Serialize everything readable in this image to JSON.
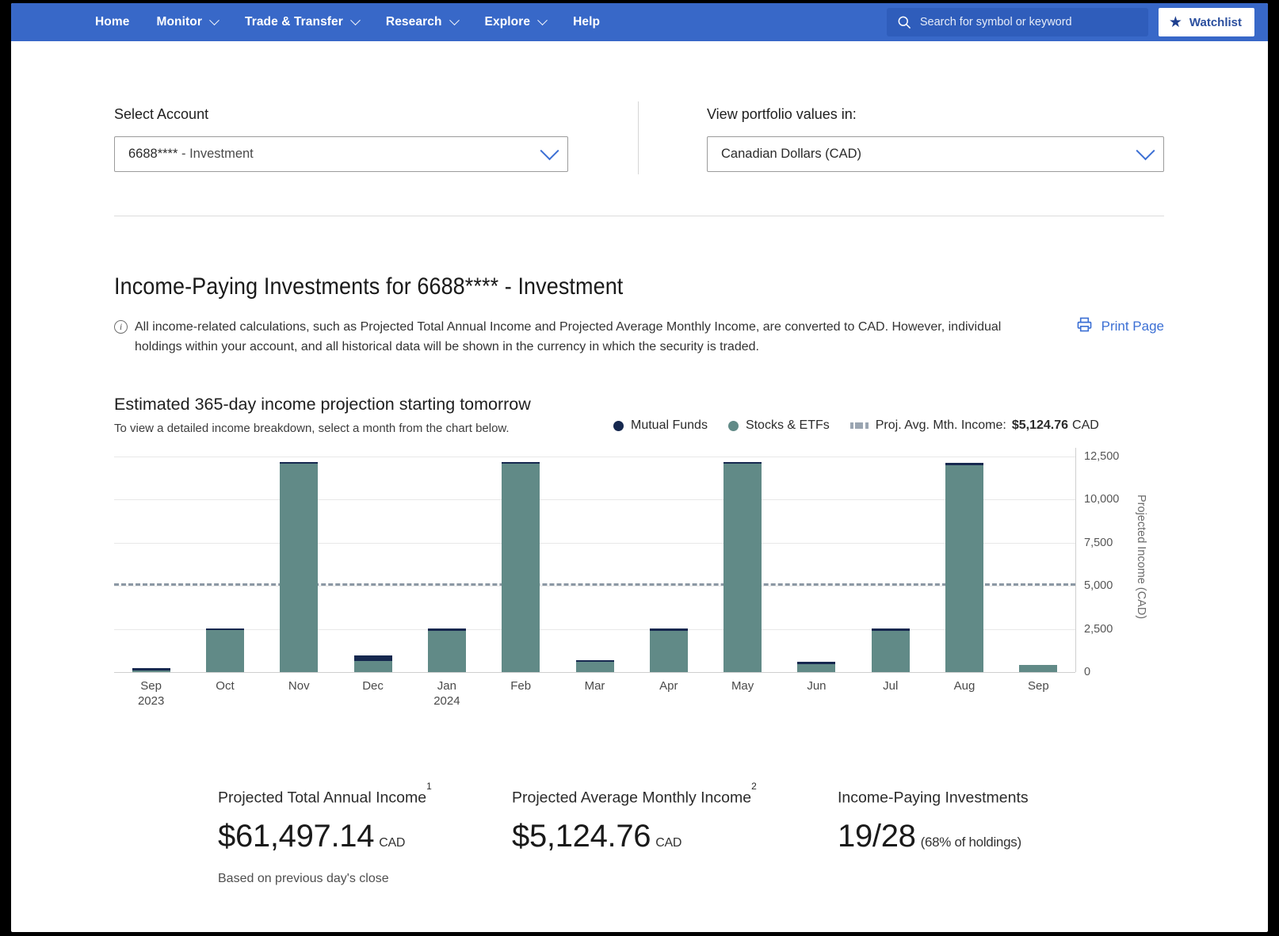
{
  "nav": {
    "items": [
      {
        "label": "Home",
        "caret": false
      },
      {
        "label": "Monitor",
        "caret": true
      },
      {
        "label": "Trade & Transfer",
        "caret": true
      },
      {
        "label": "Research",
        "caret": true
      },
      {
        "label": "Explore",
        "caret": true
      },
      {
        "label": "Help",
        "caret": false
      }
    ],
    "search_placeholder": "Search for symbol or keyword",
    "search_value": "",
    "watchlist_label": "Watchlist",
    "star_icon": "star-icon",
    "search_icon": "search-icon",
    "brand_color": "#3868c8"
  },
  "selectors": {
    "account_label": "Select Account",
    "account_value": "6688****",
    "account_value_suffix": "- Investment",
    "currency_label": "View portfolio values in:",
    "currency_value": "Canadian Dollars (CAD)"
  },
  "header": {
    "title": "Income-Paying Investments for 6688****  - Investment",
    "info_icon": "info-circle-icon",
    "info_text": "All income-related calculations, such as Projected Total Annual Income and Projected Average Monthly Income, are converted to CAD. However, individual holdings within your account, and all historical data will be shown in the currency in which the security is traded.",
    "print_label": "Print Page",
    "print_icon": "printer-icon"
  },
  "chart_section": {
    "title": "Estimated 365-day income projection starting tomorrow",
    "subtitle": "To view a detailed income breakdown, select a month from the chart below.",
    "legend": {
      "mutual_funds": "Mutual Funds",
      "stocks_etfs": "Stocks & ETFs",
      "avg_label": "Proj. Avg. Mth. Income:",
      "avg_value": "$5,124.76",
      "avg_currency": "CAD"
    }
  },
  "chart_data": {
    "type": "bar",
    "stacked": true,
    "title": "Estimated 365-day income projection starting tomorrow",
    "xlabel": "",
    "ylabel": "Projected Income (CAD)",
    "ylim": [
      0,
      13000
    ],
    "yticks": [
      0,
      2500,
      5000,
      7500,
      10000,
      12500
    ],
    "ytick_labels": [
      "0",
      "2,500",
      "5,000",
      "7,500",
      "10,000",
      "12,500"
    ],
    "grid": true,
    "legend_position": "top-right",
    "categories": [
      "Sep",
      "Oct",
      "Nov",
      "Dec",
      "Jan",
      "Feb",
      "Mar",
      "Apr",
      "May",
      "Jun",
      "Jul",
      "Aug",
      "Sep"
    ],
    "category_sublabels": [
      "2023",
      "",
      "",
      "",
      "2024",
      "",
      "",
      "",
      "",
      "",
      "",
      "",
      ""
    ],
    "series": [
      {
        "name": "Stocks & ETFs",
        "color": "#618a87",
        "values": [
          110,
          2420,
          12060,
          640,
          2410,
          12060,
          590,
          2390,
          12060,
          470,
          2390,
          12010,
          430
        ]
      },
      {
        "name": "Mutual Funds",
        "color": "#16284f",
        "values": [
          90,
          100,
          110,
          310,
          100,
          110,
          110,
          100,
          110,
          110,
          110,
          110,
          0
        ]
      }
    ],
    "annotations": [
      {
        "type": "hline",
        "label": "Proj. Avg. Mth. Income",
        "value": 5124.76,
        "style": "dashed",
        "color": "#8c98a4"
      }
    ]
  },
  "stats": [
    {
      "label": "Projected Total Annual Income",
      "footnote_marker": "1",
      "value": "$61,497.14",
      "suffix": "CAD"
    },
    {
      "label": "Projected Average Monthly Income",
      "footnote_marker": "2",
      "value": "$5,124.76",
      "suffix": "CAD"
    },
    {
      "label": "Income-Paying Investments",
      "footnote_marker": "",
      "value": "19/28",
      "suffix": "(68% of holdings)"
    }
  ],
  "footnote": "Based on previous day's close"
}
